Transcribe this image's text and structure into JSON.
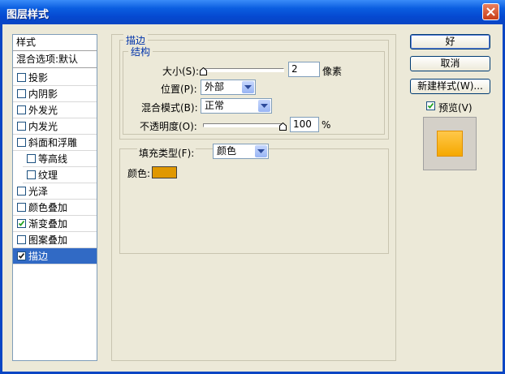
{
  "window": {
    "title": "图层样式"
  },
  "sidebar": {
    "header": "样式",
    "blend_options": "混合选项:默认",
    "items": [
      {
        "label": "投影",
        "checked": false,
        "selected": false
      },
      {
        "label": "内阴影",
        "checked": false,
        "selected": false
      },
      {
        "label": "外发光",
        "checked": false,
        "selected": false
      },
      {
        "label": "内发光",
        "checked": false,
        "selected": false
      },
      {
        "label": "斜面和浮雕",
        "checked": false,
        "selected": false
      },
      {
        "label": "等高线",
        "checked": false,
        "selected": false
      },
      {
        "label": "纹理",
        "checked": false,
        "selected": false
      },
      {
        "label": "光泽",
        "checked": false,
        "selected": false
      },
      {
        "label": "颜色叠加",
        "checked": false,
        "selected": false
      },
      {
        "label": "渐变叠加",
        "checked": true,
        "selected": false
      },
      {
        "label": "图案叠加",
        "checked": false,
        "selected": false
      },
      {
        "label": "描边",
        "checked": true,
        "selected": true
      }
    ]
  },
  "stroke": {
    "section_title": "描边",
    "structure_title": "结构",
    "size_label": "大小(S):",
    "size_value": "2",
    "size_unit": "像素",
    "position_label": "位置(P):",
    "position_value": "外部",
    "blend_label": "混合模式(B):",
    "blend_value": "正常",
    "opacity_label": "不透明度(O):",
    "opacity_value": "100",
    "opacity_unit": "%",
    "fill_type_label": "填充类型(F):",
    "fill_type_value": "颜色",
    "color_label": "颜色:",
    "color_hex": "#e09800"
  },
  "buttons": {
    "ok": "好",
    "cancel": "取消",
    "new_style": "新建样式(W)...",
    "preview_label": "预览(V)",
    "preview_checked": true
  },
  "preview": {
    "fill_color": "#f5a800"
  },
  "colors": {
    "titlebar": "#0a5de0",
    "selection": "#316ac5",
    "group_title": "#0033aa"
  }
}
